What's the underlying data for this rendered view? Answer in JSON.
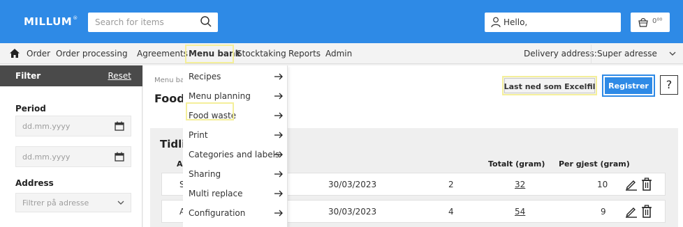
{
  "header": {
    "logo": "MILLUM",
    "logo_mark": "®",
    "search_placeholder": "Search for items",
    "greeting": "Hello,",
    "cart_amount": "0⁰⁰",
    "brand_color": "#2e8ae6"
  },
  "nav": {
    "items": [
      "Order",
      "Order processing",
      "Agreements",
      "Menu bank",
      "Stocktaking",
      "Reports",
      "Admin"
    ],
    "active": "Menu bank",
    "delivery_label": "Delivery address:",
    "delivery_value": "Super adresse"
  },
  "sidebar": {
    "title": "Filter",
    "reset": "Reset",
    "period_label": "Period",
    "date_placeholder_1": "dd.mm.yyyy",
    "date_placeholder_2": "dd.mm.yyyy",
    "address_label": "Address",
    "address_placeholder": "Filtrer på adresse"
  },
  "main": {
    "breadcrumb": "Menu ba",
    "page_title": "Food",
    "excel_button": "Last ned som Excelfil",
    "register_button": "Registrer",
    "help_button": "?",
    "panel_title": "Tidli",
    "columns": {
      "a": "A",
      "total": "Totalt (gram)",
      "per_guest": "Per gjest (gram)"
    },
    "rows": [
      {
        "first": "S",
        "date": "30/03/2023",
        "count": "2",
        "total": "32",
        "per_guest": "10"
      },
      {
        "first": "A",
        "date": "30/03/2023",
        "count": "4",
        "total": "54",
        "per_guest": "9"
      }
    ]
  },
  "menu": {
    "items": [
      {
        "label": "Recipes",
        "icon": "arrow-right-icon"
      },
      {
        "label": "Menu planning",
        "icon": "arrow-right-icon"
      },
      {
        "label": "Food waste",
        "icon": "arrow-right-icon"
      },
      {
        "label": "Print",
        "icon": "arrow-right-icon"
      },
      {
        "label": "Categories and labels",
        "icon": "arrow-right-icon"
      },
      {
        "label": "Sharing",
        "icon": "arrow-right-icon"
      },
      {
        "label": "Multi replace",
        "icon": "arrow-right-icon"
      },
      {
        "label": "Configuration",
        "icon": "arrow-right-icon"
      }
    ]
  }
}
